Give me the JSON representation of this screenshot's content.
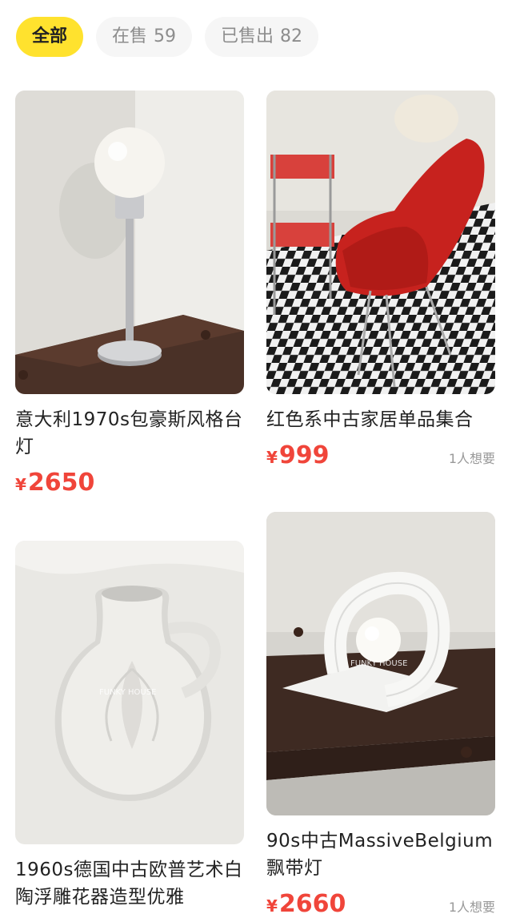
{
  "tabs": [
    {
      "label": "全部",
      "count": ""
    },
    {
      "label": "在售",
      "count": "59"
    },
    {
      "label": "已售出",
      "count": "82"
    }
  ],
  "products": {
    "left": [
      {
        "title": "意大利1970s包豪斯风格台灯",
        "currency": "¥",
        "price": "2650",
        "wants": ""
      },
      {
        "title": "1960s德国中古欧普艺术白陶浮雕花器造型优雅",
        "currency": "",
        "price": "",
        "wants": ""
      }
    ],
    "right": [
      {
        "title": "红色系中古家居单品集合",
        "currency": "¥",
        "price": "999",
        "wants": "1人想要"
      },
      {
        "title": "90s中古MassiveBelgium飘带灯",
        "currency": "¥",
        "price": "2660",
        "wants": "1人想要"
      }
    ]
  },
  "watermark": "FUNKY HOUSE",
  "colors": {
    "accent": "#ffe22e",
    "price": "#f0453a"
  }
}
